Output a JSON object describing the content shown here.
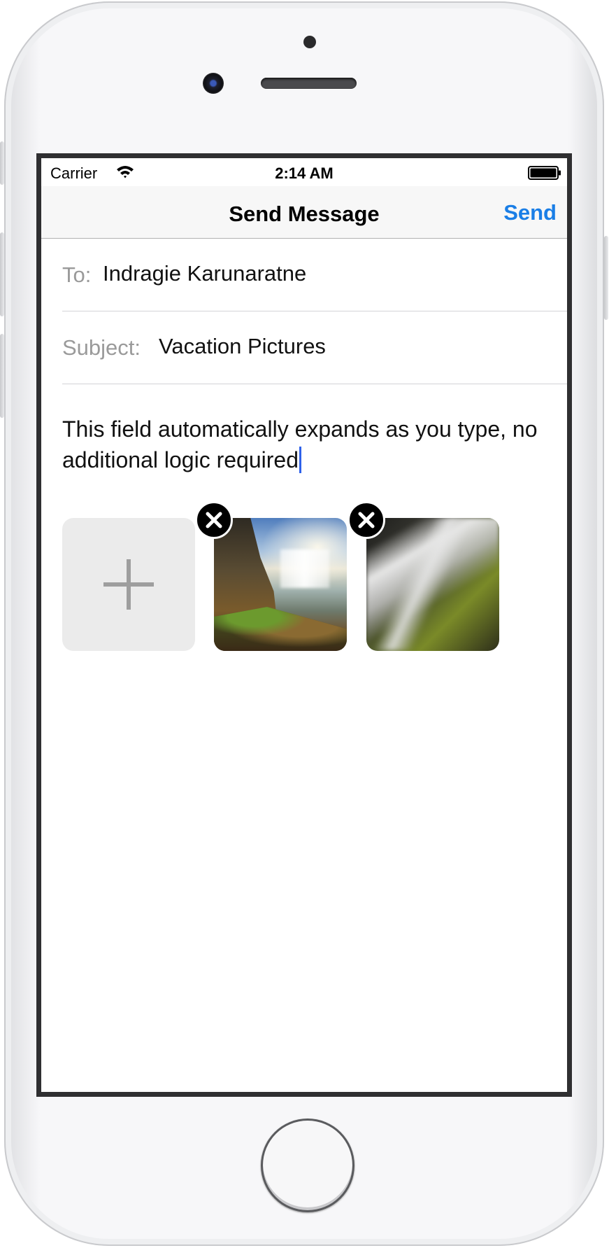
{
  "status_bar": {
    "carrier": "Carrier",
    "time": "2:14 AM",
    "icons": [
      "wifi-icon",
      "battery-icon"
    ]
  },
  "nav_bar": {
    "title": "Send Message",
    "send_label": "Send"
  },
  "form": {
    "to_label": "To:",
    "to_value": "Indragie Karunaratne",
    "subject_label": "Subject:",
    "subject_value": "Vacation Pictures",
    "body_value": "This field automatically expands as you type, no additional logic required"
  },
  "attachments": {
    "add_icon": "plus-icon",
    "remove_icon": "close-icon",
    "photos": [
      "waterfall-photo",
      "cascade-photo"
    ]
  },
  "colors": {
    "accent": "#1a7ee6",
    "caret": "#2f62ea",
    "label_gray": "#9a9a9a",
    "nav_bg": "#f7f7f7",
    "add_tile_bg": "#ebebeb"
  }
}
